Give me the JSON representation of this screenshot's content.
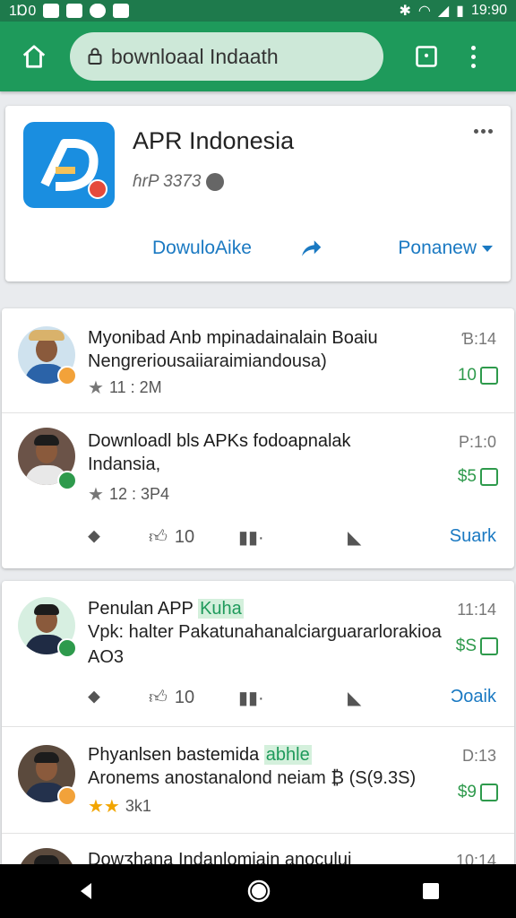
{
  "status_bar": {
    "left_text": "1Ɒ0",
    "time": "19:90"
  },
  "toolbar": {
    "url": "bownloaal Indaath"
  },
  "app": {
    "name": "APR Indonesia",
    "meta": "ɦrP 3373",
    "download_label": "DowuloAike",
    "sort_label": "Ponanew"
  },
  "posts": [
    {
      "title": "Myonibad Anb mpinadainalain Boaiu",
      "sub": "Nengreriousaiiaraimiandousa)",
      "rating": "11 : 2M",
      "time": "Ɓ:14",
      "price": "10",
      "badge_color": "#f2a23a"
    },
    {
      "title": "Downloadl bls APKs fodoapnalak",
      "sub": "Indansia,",
      "rating": "12 : 3P4",
      "time": "P:1:0",
      "price": "$5",
      "badge_color": "#2e9a4c"
    },
    {
      "title": "Penulan APP",
      "highlight": "Kuha",
      "sub": "Vpk: halter Pakatunahanalciarguararlorakioa",
      "sub2": "AO3",
      "rating": "",
      "time": "11:14",
      "price": "$S",
      "badge_color": "#2e9a4c"
    },
    {
      "title": "Phyanlsen bastemida",
      "highlight": "abhle",
      "sub": "Aronems anostanalond neiam ₿ (S(9.3S)",
      "rating": "3k1",
      "time": "D:13",
      "price": "$9",
      "badge_color": "#f2a23a"
    },
    {
      "title": "Dowʒhana Indanlomiain anocului",
      "time": "10:14"
    }
  ],
  "actions_1": {
    "like_count": "10",
    "link": "Suark"
  },
  "actions_2": {
    "like_count": "10",
    "link": "Ɔoaik"
  },
  "colors": {
    "toolbar": "#1e9a5b",
    "status_bar": "#1e7a4c",
    "accent_blue": "#1a79c2",
    "price_green": "#2e9a4c"
  }
}
